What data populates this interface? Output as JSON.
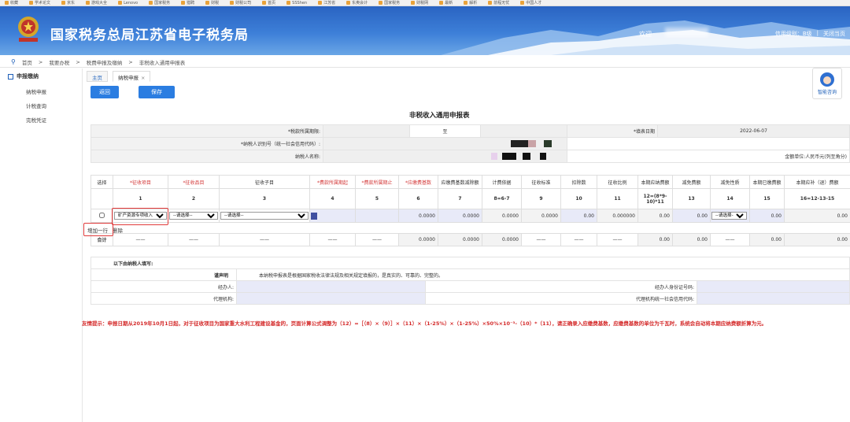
{
  "bookmarks": [
    "收藏",
    "学术论文",
    "京东",
    "游戏大全",
    "Lenovo",
    "国家税务",
    "猎聘",
    "财税",
    "财税公司",
    "首页",
    "SSShen",
    "江苏省",
    "东奥会计",
    "国家税务",
    "财税网",
    "最新",
    "解析",
    "前程无忧",
    "中国人才"
  ],
  "header": {
    "site_title": "国家税务总局江苏省电子税务局",
    "welcome": "欢迎",
    "credit_level": "信用级别：B级",
    "close_page": "关闭当页"
  },
  "breadcrumb": [
    "首页",
    "我要办税",
    "税费申报及缴纳",
    "非税收入通用申报表"
  ],
  "sidebar": {
    "section": "申报缴纳",
    "items": [
      "纳税申报",
      "计税查询",
      "完税凭证"
    ]
  },
  "tabs": [
    "主页",
    "纳税申报"
  ],
  "buttons": {
    "back": "返回",
    "save": "保存"
  },
  "help": "智能咨询",
  "form": {
    "title": "非税收入通用申报表",
    "period_label": "*税款所属期限:",
    "period_to": "至",
    "fill_date_label": "*填表日期",
    "fill_date": "2022-06-07",
    "taxpayer_id_label": "*纳税人识别号（统一社会信用代码）:",
    "taxpayer_name_label": "纳税人名称:",
    "unit_label": "金额单位:人民币元(列至角分)"
  },
  "grid": {
    "headers": [
      "选择",
      "*征收项目",
      "*征收品目",
      "征收子目",
      "*费款所属期起",
      "*费款所属期止",
      "*应缴费基数",
      "应缴费基数减除额",
      "计费依据",
      "征收标准",
      "扣除数",
      "征收比例",
      "本期应纳费额",
      "减免费额",
      "减免性质",
      "本期已缴费额",
      "本期应补（退）费额"
    ],
    "numbers": [
      "",
      "1",
      "2",
      "3",
      "4",
      "5",
      "6",
      "7",
      "8=6-7",
      "9",
      "10",
      "11",
      "12=(8*9-10)*11",
      "13",
      "14",
      "15",
      "16=12-13-15"
    ],
    "row": {
      "project": "矿产资源专项收入",
      "item_placeholder": "--请选择--",
      "subitem_placeholder": "--请选择--",
      "c6": "0.0000",
      "c7": "0.0000",
      "c8": "0.0000",
      "c9": "0.0000",
      "c10": "0.00",
      "c11": "0.000000",
      "c12": "0.00",
      "c13": "0.00",
      "c14_placeholder": "--请选择--",
      "c15": "0.00",
      "c16": "0.00"
    },
    "add_row": "增加一行",
    "delete": "删除",
    "sum": {
      "label": "合计",
      "dash": "——",
      "c6": "0.0000",
      "c7": "0.0000",
      "c8": "0.0000",
      "c12": "0.00",
      "c13": "0.00",
      "c15": "0.00",
      "c16": "0.00"
    }
  },
  "declaration": {
    "header": "以下由纳税人填写:",
    "label": "谨声明",
    "text": "本纳税申报表是根据国家税收法律法规及相关规定填报的，是真实的、可靠的、完整的。",
    "handler": "经办人:",
    "handler_id": "经办人身份证号码:",
    "agency": "代理机构:",
    "agency_code": "代理机构统一社会信用代码:"
  },
  "notice": "友情提示：申报日期从2019年10月1日起，对于征收项目为国家重大水利工程建设基金的，页面计算公式调整为（12）=［（8）×（9）］×（11）×（1-25%）×（1-25%）×50%×10⁻³-（10）*（11），请正确录入应缴费基数，应缴费基数的单位为千瓦时，系统会自动将本期应纳费额折算为元。",
  "colors": {
    "header_blue": "#2a64c2",
    "button_blue": "#2b7de1",
    "highlight_red": "#e03a3a",
    "shade_blue": "#e8eaf8"
  }
}
